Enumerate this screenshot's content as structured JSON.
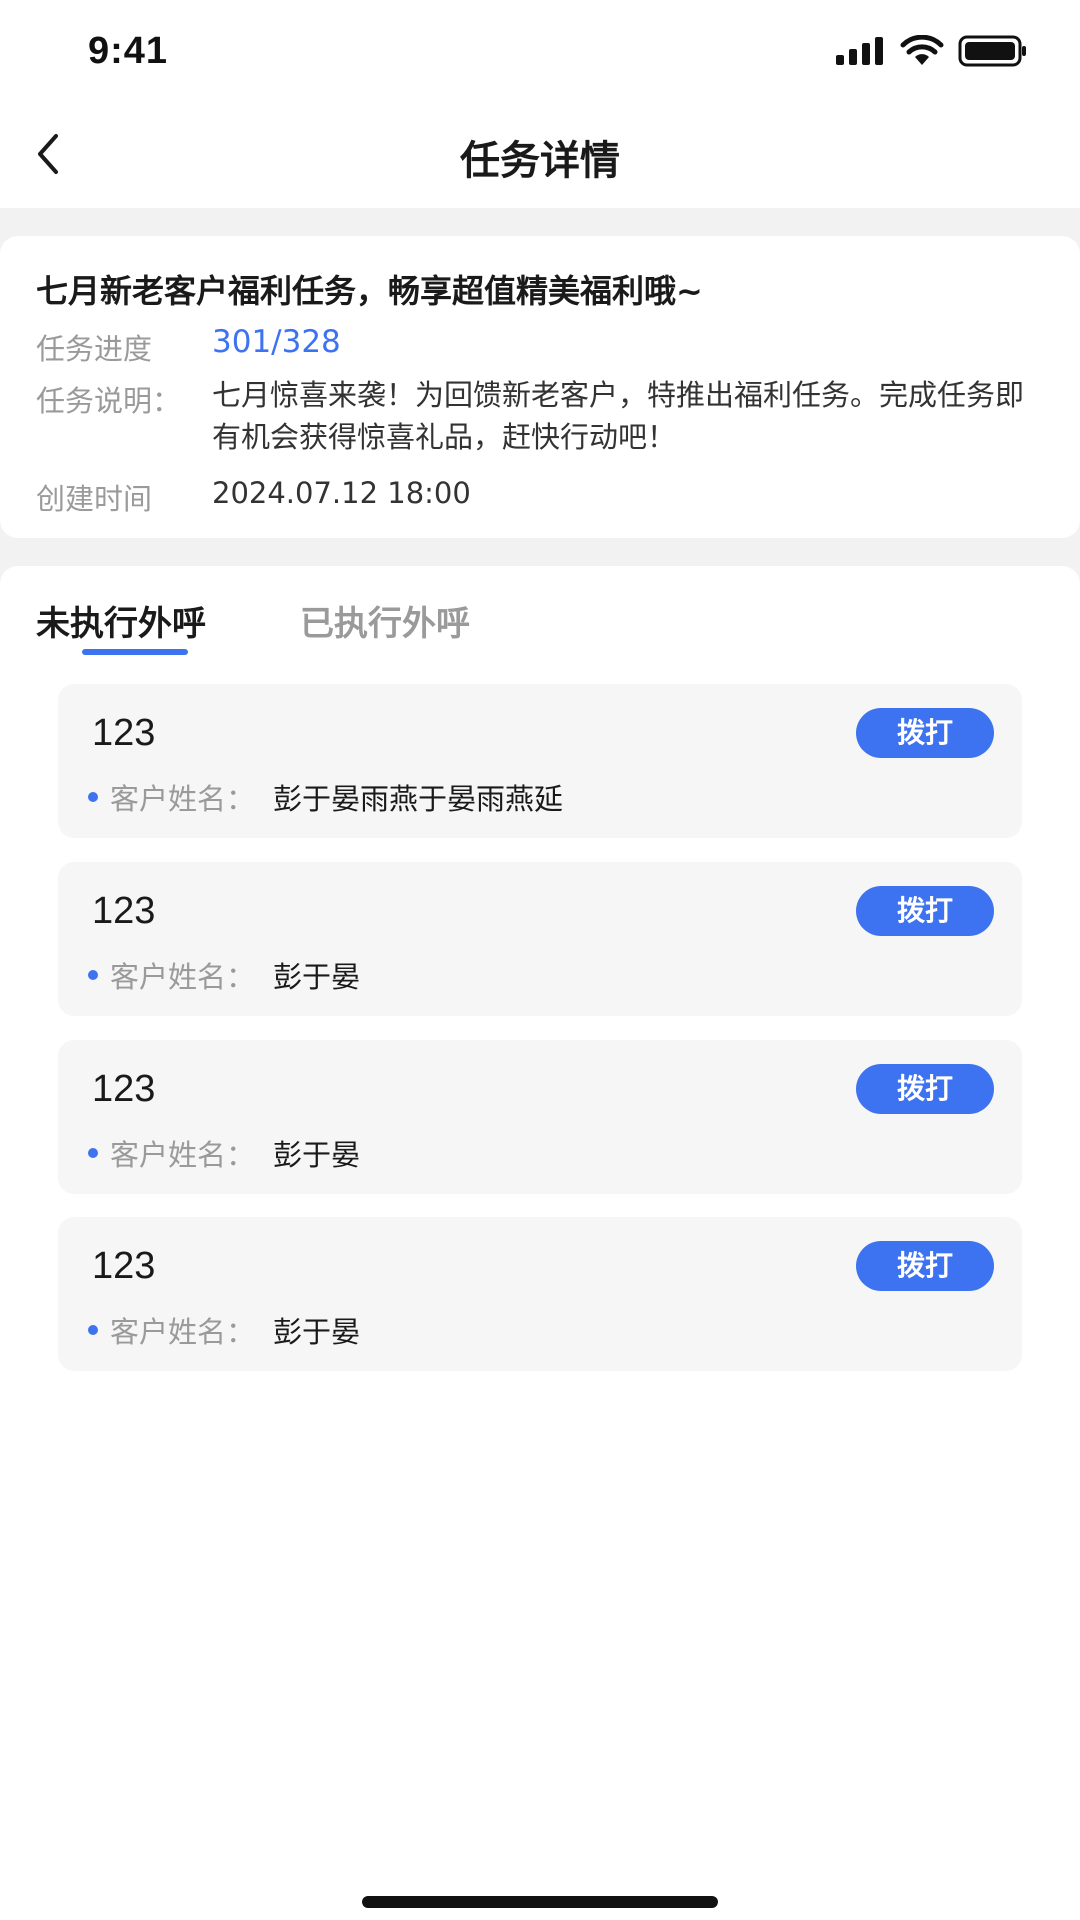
{
  "status_bar": {
    "time": "9:41",
    "icons": [
      "signal-icon",
      "wifi-icon",
      "battery-icon"
    ]
  },
  "nav": {
    "title": "任务详情",
    "back_icon": "chevron-left-icon"
  },
  "task": {
    "title": "七月新老客户福利任务，畅享超值精美福利哦~",
    "progress_label": "任务进度",
    "progress_value": "301/328",
    "description_label": "任务说明：",
    "description_value": "七月惊喜来袭！为回馈新老客户，特推出福利任务。完成任务即有机会获得惊喜礼品，赶快行动吧！",
    "created_label": "创建时间",
    "created_value": "2024.07.12 18:00"
  },
  "tabs": [
    {
      "label": "未执行外呼",
      "active": true
    },
    {
      "label": "已执行外呼",
      "active": false
    }
  ],
  "calls": [
    {
      "number": "123",
      "button_label": "拨打",
      "customer_label": "客户姓名：",
      "customer_name": "彭于晏雨燕于晏雨燕延"
    },
    {
      "number": "123",
      "button_label": "拨打",
      "customer_label": "客户姓名：",
      "customer_name": "彭于晏"
    },
    {
      "number": "123",
      "button_label": "拨打",
      "customer_label": "客户姓名：",
      "customer_name": "彭于晏"
    },
    {
      "number": "123",
      "button_label": "拨打",
      "customer_label": "客户姓名：",
      "customer_name": "彭于晏"
    }
  ],
  "colors": {
    "accent": "#3d73f0",
    "page_background": "#f2f2f2",
    "card_background": "#f6f6f6"
  }
}
